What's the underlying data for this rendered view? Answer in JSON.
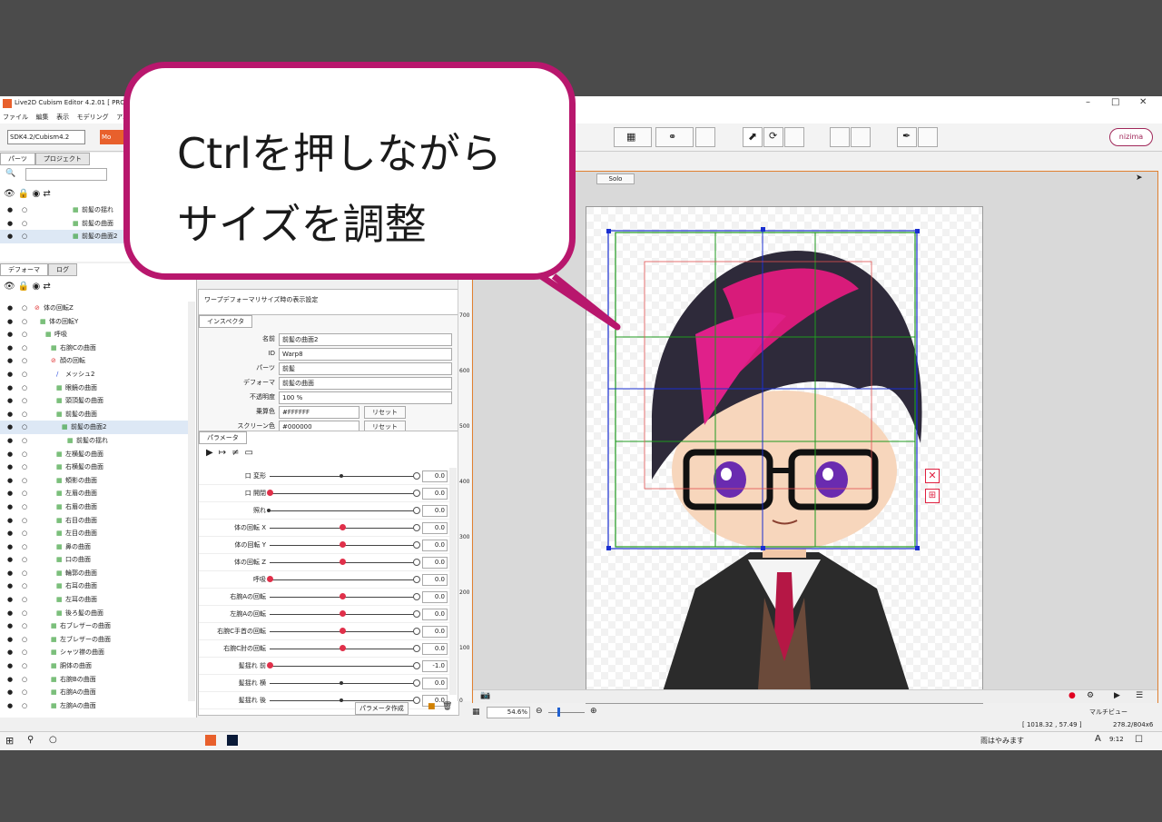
{
  "app": {
    "title": "Live2D Cubism Editor 4.2.01  [ PRO",
    "menu": [
      "ファイル",
      "編集",
      "表示",
      "モデリング",
      "アニメー"
    ],
    "sdk_select": "SDK4.2/Cubism4.2",
    "mode_button": "Mo",
    "nizima_button": "nizima",
    "window_controls": [
      "–",
      "□",
      "✕"
    ]
  },
  "callout": {
    "line1": "Ctrlを押しながら",
    "line2": "サイズを調整",
    "border_color": "#b8176d"
  },
  "parts_panel": {
    "tabs": [
      "パーツ",
      "プロジェクト"
    ],
    "items": [
      "前髪の揺れ",
      "前髪の曲面",
      "前髪の曲面2"
    ]
  },
  "deformer_panel": {
    "tabs": [
      "デフォーマ",
      "ログ"
    ],
    "items": [
      {
        "label": "体の回転Z",
        "indent": 0,
        "kind": "rot"
      },
      {
        "label": "体の回転Y",
        "indent": 1,
        "kind": "warp"
      },
      {
        "label": "呼吸",
        "indent": 2,
        "kind": "warp"
      },
      {
        "label": "右腕Cの曲面",
        "indent": 3,
        "kind": "warp"
      },
      {
        "label": "顔の回転",
        "indent": 3,
        "kind": "rot"
      },
      {
        "label": "メッシュ2",
        "indent": 4,
        "kind": "mesh"
      },
      {
        "label": "眼鏡の曲面",
        "indent": 4,
        "kind": "warp"
      },
      {
        "label": "頭頂髪の曲面",
        "indent": 4,
        "kind": "warp"
      },
      {
        "label": "前髪の曲面",
        "indent": 4,
        "kind": "warp"
      },
      {
        "label": "前髪の曲面2",
        "indent": 5,
        "kind": "warp",
        "selected": true
      },
      {
        "label": "前髪の揺れ",
        "indent": 6,
        "kind": "warp"
      },
      {
        "label": "左横髪の曲面",
        "indent": 4,
        "kind": "warp"
      },
      {
        "label": "右横髪の曲面",
        "indent": 4,
        "kind": "warp"
      },
      {
        "label": "頬影の曲面",
        "indent": 4,
        "kind": "warp"
      },
      {
        "label": "左眉の曲面",
        "indent": 4,
        "kind": "warp"
      },
      {
        "label": "右眉の曲面",
        "indent": 4,
        "kind": "warp"
      },
      {
        "label": "右目の曲面",
        "indent": 4,
        "kind": "warp"
      },
      {
        "label": "左目の曲面",
        "indent": 4,
        "kind": "warp"
      },
      {
        "label": "鼻の曲面",
        "indent": 4,
        "kind": "warp"
      },
      {
        "label": "口の曲面",
        "indent": 4,
        "kind": "warp"
      },
      {
        "label": "輪郭の曲面",
        "indent": 4,
        "kind": "warp"
      },
      {
        "label": "右耳の曲面",
        "indent": 4,
        "kind": "warp"
      },
      {
        "label": "左耳の曲面",
        "indent": 4,
        "kind": "warp"
      },
      {
        "label": "後ろ髪の曲面",
        "indent": 4,
        "kind": "warp"
      },
      {
        "label": "右ブレザーの曲面",
        "indent": 3,
        "kind": "warp"
      },
      {
        "label": "左ブレザーの曲面",
        "indent": 3,
        "kind": "warp"
      },
      {
        "label": "シャツ襟の曲面",
        "indent": 3,
        "kind": "warp"
      },
      {
        "label": "胴体の曲面",
        "indent": 3,
        "kind": "warp"
      },
      {
        "label": "右腕Bの曲面",
        "indent": 3,
        "kind": "warp"
      },
      {
        "label": "右腕Aの曲面",
        "indent": 3,
        "kind": "warp"
      },
      {
        "label": "左腕Aの曲面",
        "indent": 3,
        "kind": "warp"
      }
    ]
  },
  "tool_settings": {
    "text": "ワープデフォーマリサイズ時の表示設定"
  },
  "inspector": {
    "tab": "インスペクタ",
    "rows": [
      {
        "key": "名前",
        "value": "前髪の曲面2"
      },
      {
        "key": "ID",
        "value": "Warp8"
      },
      {
        "key": "パーツ",
        "value": "前髪"
      },
      {
        "key": "デフォーマ",
        "value": "前髪の曲面"
      },
      {
        "key": "不透明度",
        "value": "100 %"
      },
      {
        "key": "乗算色",
        "value": "#FFFFFF",
        "reset": "リセット"
      },
      {
        "key": "スクリーン色",
        "value": "#000000",
        "reset": "リセット"
      }
    ]
  },
  "parameters": {
    "tab": "パラメータ",
    "create_button": "パラメータ作成",
    "rows": [
      {
        "name": "口 変形",
        "value": "0.0",
        "pos": 0.5,
        "type": "center"
      },
      {
        "name": "口 開閉",
        "value": "0.0",
        "pos": 0.0,
        "type": "red"
      },
      {
        "name": "照れ",
        "value": "0.0",
        "pos": 0.0,
        "type": "plain"
      },
      {
        "name": "体の回転 X",
        "value": "0.0",
        "pos": 0.5,
        "type": "red"
      },
      {
        "name": "体の回転 Y",
        "value": "0.0",
        "pos": 0.5,
        "type": "red"
      },
      {
        "name": "体の回転 Z",
        "value": "0.0",
        "pos": 0.5,
        "type": "red"
      },
      {
        "name": "呼吸",
        "value": "0.0",
        "pos": 0.0,
        "type": "red"
      },
      {
        "name": "右腕Aの回転",
        "value": "0.0",
        "pos": 0.5,
        "type": "red"
      },
      {
        "name": "左腕Aの回転",
        "value": "0.0",
        "pos": 0.5,
        "type": "red"
      },
      {
        "name": "右腕C手首の回転",
        "value": "0.0",
        "pos": 0.5,
        "type": "red"
      },
      {
        "name": "右腕C肘の回転",
        "value": "0.0",
        "pos": 0.5,
        "type": "red"
      },
      {
        "name": "髪揺れ 前",
        "value": "-1.0",
        "pos": 0.0,
        "type": "red"
      },
      {
        "name": "髪揺れ 横",
        "value": "0.0",
        "pos": 0.5,
        "type": "plain"
      },
      {
        "name": "髪揺れ 後",
        "value": "0.0",
        "pos": 0.5,
        "type": "plain"
      }
    ]
  },
  "viewport": {
    "solo_label": "Solo",
    "zoom": "54.6%",
    "ruler": [
      "700",
      "600",
      "500",
      "400",
      "300",
      "200",
      "100",
      "0"
    ],
    "multiview": "マルチビュー",
    "coords": "[ 1018.32 ,   57.49 ]",
    "coords2": "278.2/804x6"
  },
  "taskbar": {
    "weather": "雨はやみます",
    "time": "9:12",
    "ime": "A"
  }
}
